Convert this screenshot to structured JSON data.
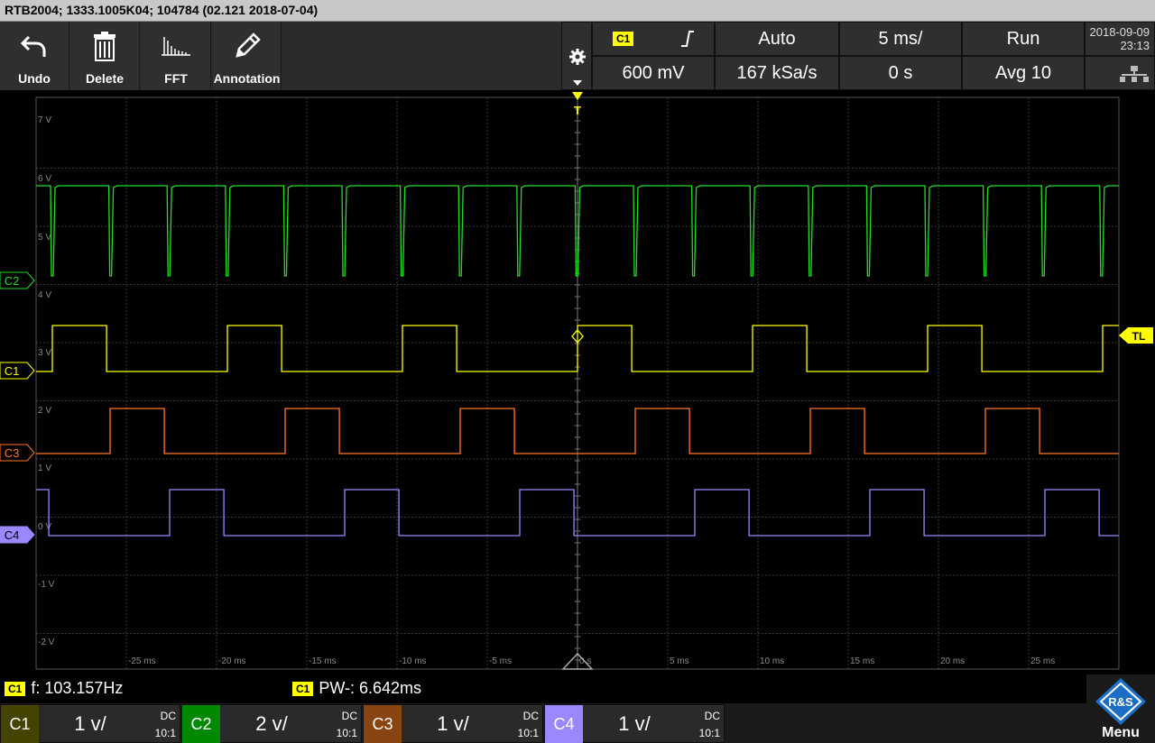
{
  "title": "RTB2004; 1333.1005K04; 104784 (02.121 2018-07-04)",
  "toolbar": {
    "buttons": [
      {
        "label": "Undo",
        "icon": "undo-icon"
      },
      {
        "label": "Delete",
        "icon": "trash-icon"
      },
      {
        "label": "FFT",
        "icon": "fft-icon"
      },
      {
        "label": "Annotation",
        "icon": "pen-icon"
      }
    ]
  },
  "settings": {
    "trigger_source": "C1",
    "trigger_level": "600 mV",
    "trigger_mode": "Auto",
    "sample_rate": "167 kSa/s",
    "time_scale": "5 ms/",
    "time_offset": "0 s",
    "run_state": "Run",
    "acquire": "Avg 10"
  },
  "datetime": {
    "date": "2018-09-09",
    "time": "23:13"
  },
  "grid": {
    "y_labels": [
      "7 V",
      "6 V",
      "5 V",
      "4 V",
      "3 V",
      "2 V",
      "1 V",
      "0 V",
      "-1 V",
      "-2 V"
    ],
    "x_labels": [
      "-25 ms",
      "-20 ms",
      "-15 ms",
      "-10 ms",
      "-5 ms",
      "0 s",
      "5 ms",
      "10 ms",
      "15 ms",
      "20 ms",
      "25 ms"
    ]
  },
  "markers": {
    "trigger": "T",
    "trigger_level": "TL",
    "ch_markers": [
      "C2",
      "C1",
      "C3",
      "C4"
    ]
  },
  "colors": {
    "C1": "#ffff00",
    "C2": "#22dd22",
    "C3": "#ff7722",
    "C4": "#9988ff",
    "grid": "#3a3a3a",
    "axis": "#777777"
  },
  "measurements": [
    {
      "source": "C1",
      "text": "f: 103.157Hz"
    },
    {
      "source": "C1",
      "text": "PW-: 6.642ms"
    }
  ],
  "channels": [
    {
      "name": "C1",
      "scale": "1 v/",
      "coupling": "DC",
      "probe": "10:1",
      "color": "#ffff00"
    },
    {
      "name": "C2",
      "scale": "2 v/",
      "coupling": "DC",
      "probe": "10:1",
      "color": "#00aa00"
    },
    {
      "name": "C3",
      "scale": "1 v/",
      "coupling": "DC",
      "probe": "10:1",
      "color": "#aa5511"
    },
    {
      "name": "C4",
      "scale": "1 v/",
      "coupling": "DC",
      "probe": "10:1",
      "color": "#9988ff"
    }
  ],
  "menu_label": "Menu",
  "logo_text": "R&S"
}
